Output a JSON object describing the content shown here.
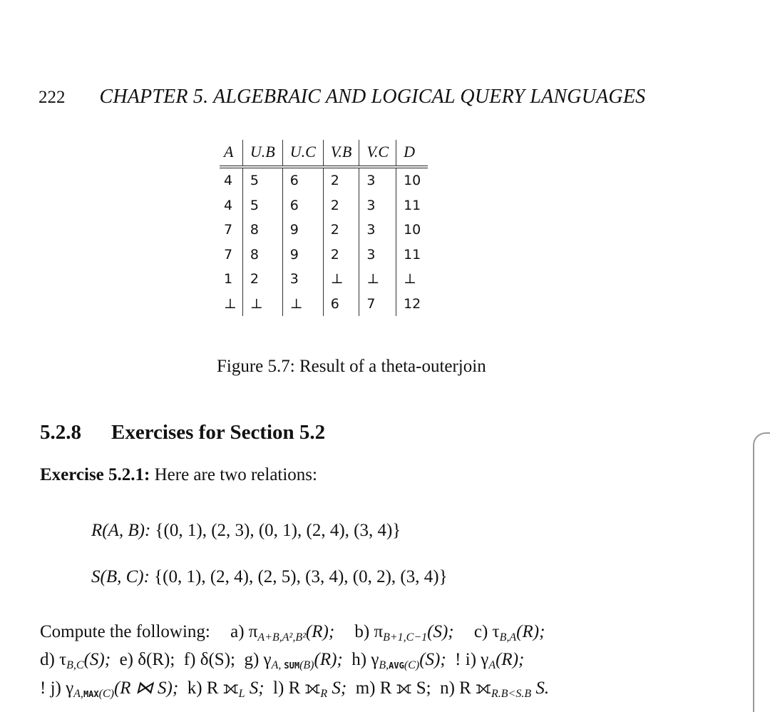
{
  "header": {
    "page_number": "222",
    "chapter_title": "CHAPTER 5.  ALGEBRAIC AND LOGICAL QUERY LANGUAGES"
  },
  "figure": {
    "columns": [
      "A",
      "U.B",
      "U.C",
      "V.B",
      "V.C",
      "D"
    ],
    "rows": [
      [
        "4",
        "5",
        "6",
        "2",
        "3",
        "10"
      ],
      [
        "4",
        "5",
        "6",
        "2",
        "3",
        "11"
      ],
      [
        "7",
        "8",
        "9",
        "2",
        "3",
        "10"
      ],
      [
        "7",
        "8",
        "9",
        "2",
        "3",
        "11"
      ],
      [
        "1",
        "2",
        "3",
        "⊥",
        "⊥",
        "⊥"
      ],
      [
        "⊥",
        "⊥",
        "⊥",
        "6",
        "7",
        "12"
      ]
    ],
    "caption": "Figure 5.7: Result of a theta-outerjoin"
  },
  "section": {
    "number": "5.2.8",
    "title": "Exercises for Section 5.2"
  },
  "exercise": {
    "label": "Exercise 5.2.1:",
    "intro": "Here are two relations:",
    "relations": [
      {
        "name": "R(A, B):",
        "tuples": "{(0, 1),  (2, 3),  (0, 1),  (2, 4),  (3, 4)}"
      },
      {
        "name": "S(B, C):",
        "tuples": "{(0, 1),  (2, 4),  (2, 5),  (3, 4),  (0, 2),  (3, 4)}"
      }
    ],
    "compute_label": "Compute the following:",
    "items": {
      "a": "a) π",
      "a_sub": "A+B,A²,B²",
      "a_arg": "(R);",
      "b": "b) π",
      "b_sub": "B+1,C−1",
      "b_arg": "(S);",
      "c": "c) τ",
      "c_sub": "B,A",
      "c_arg": "(R);",
      "d": "d) τ",
      "d_sub": "B,C",
      "d_arg": "(S);",
      "e": "e) δ(R);",
      "f": "f) δ(S);",
      "g": "g) γ",
      "g_sub_a": "A, ",
      "g_sub_agg": "SUM",
      "g_sub_b": "(B)",
      "g_arg": "(R);",
      "h": "h) γ",
      "h_sub_a": "B,",
      "h_sub_agg": "AVG",
      "h_sub_b": "(C)",
      "h_arg": "(S);",
      "i": "! i) γ",
      "i_sub": "A",
      "i_arg": "(R);",
      "j": "! j) γ",
      "j_sub_a": "A,",
      "j_sub_agg": "MAX",
      "j_sub_b": "(C)",
      "j_arg": "(R ⋈ S);",
      "k": "k) R ⟗",
      "k_sub": "L",
      "k_arg": " S;",
      "l": "l) R ⟗",
      "l_sub": "R",
      "l_arg": " S;",
      "m": "m) R ⟗ S;",
      "n": "n) R ⟗",
      "n_sub": "R.B<S.B",
      "n_arg": " S."
    }
  }
}
